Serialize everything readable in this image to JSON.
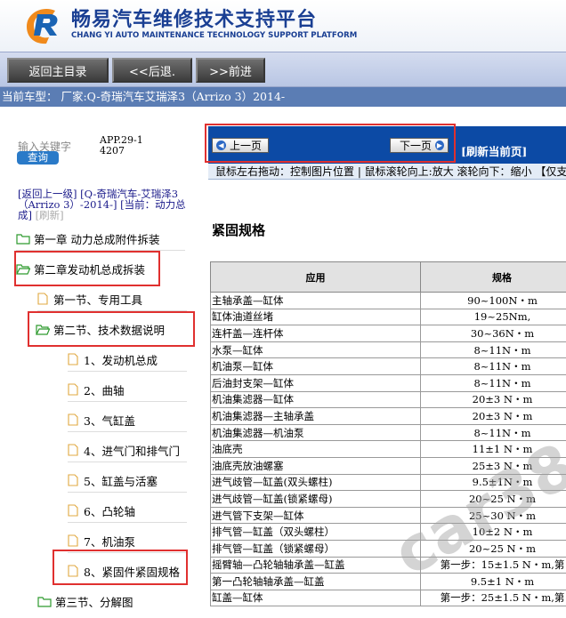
{
  "header": {
    "title_cn": "畅易汽车维修技术支持平台",
    "title_en": "CHANG YI AUTO MAINTENANCE TECHNOLOGY SUPPORT PLATFORM",
    "brand_colors": {
      "primary": "#1a3f93",
      "logo_orange": "#f08a1c",
      "logo_blue": "#1a64b4"
    }
  },
  "navbar": {
    "back_main": "返回主目录",
    "back": "<<后退.",
    "forward": ">>前进"
  },
  "vehicle": {
    "label": "当前车型： 厂家:Q-奇瑞汽车艾瑞泽3（Arrizo 3）2014-"
  },
  "sidebar": {
    "search_placeholder": "输入关键字",
    "search_button": "查询",
    "app_code": "APP.29-14207",
    "breadcrumb_back": "[返回上一级]",
    "breadcrumb_path": "[Q-奇瑞汽车-艾瑞泽3（Arrizo 3）-2014-]",
    "breadcrumb_current": "[当前：动力总成]",
    "breadcrumb_refresh": "[刷新]",
    "tree": [
      {
        "label": "第一章 动力总成附件拆装",
        "type": "folder"
      },
      {
        "label": "第二章发动机总成拆装",
        "type": "folder-open"
      },
      {
        "label": "第一节、专用工具",
        "type": "doc"
      },
      {
        "label": "第二节、技术数据说明",
        "type": "folder-open"
      },
      {
        "label": "1、发动机总成",
        "type": "doc"
      },
      {
        "label": "2、曲轴",
        "type": "doc"
      },
      {
        "label": "3、气缸盖",
        "type": "doc"
      },
      {
        "label": "4、进气门和排气门",
        "type": "doc"
      },
      {
        "label": "5、缸盖与活塞",
        "type": "doc"
      },
      {
        "label": "6、凸轮轴",
        "type": "doc"
      },
      {
        "label": "7、机油泵",
        "type": "doc"
      },
      {
        "label": "8、紧固件紧固规格",
        "type": "doc"
      },
      {
        "label": "第三节、分解图",
        "type": "folder"
      }
    ]
  },
  "content": {
    "prev_page": "上一页",
    "next_page": "下一页",
    "refresh_page": "[刷新当前页]",
    "hint": "鼠标左右拖动：控制图片位置 | 鼠标滚轮向上:放大  滚轮向下：缩小 【仅支",
    "doc_title": "紧固规格",
    "table_headers": [
      "应用",
      "规格"
    ],
    "rows": [
      [
        "主轴承盖—缸体",
        "90~100N・m"
      ],
      [
        "缸体油道丝堵",
        "19~25Nm,"
      ],
      [
        "连杆盖—连杆体",
        "30~36N・m"
      ],
      [
        "水泵—缸体",
        "8~11N・m"
      ],
      [
        "机油泵—缸体",
        "8~11N・m"
      ],
      [
        "后油封支架—缸体",
        "8~11N・m"
      ],
      [
        "机油集滤器—缸体",
        "20±3 N・m"
      ],
      [
        "机油集滤器—主轴承盖",
        "20±3 N・m"
      ],
      [
        "机油集滤器—机油泵",
        "8~11N・m"
      ],
      [
        "油底壳",
        "11±1 N・m"
      ],
      [
        "油底壳放油螺塞",
        "25±3 N・m"
      ],
      [
        "进气歧管—缸盖(双头螺柱)",
        "9.5±1N・m"
      ],
      [
        "进气歧管—缸盖(锁紧螺母)",
        "20~25 N・m"
      ],
      [
        "进气管下支架—缸体",
        "25~30 N・m"
      ],
      [
        "排气管—缸盖（双头螺柱）",
        "10±2 N・m"
      ],
      [
        "排气管—缸盖（锁紧螺母）",
        "20~25 N・m"
      ],
      [
        "摇臂轴—凸轮轴轴承盖—缸盖",
        "第一步：15±1.5 N・m,第"
      ],
      [
        "第一凸轮轴轴承盖—缸盖",
        "9.5±1 N・m"
      ],
      [
        "缸盖—缸体",
        "第一步：25±1.5 N・m,第"
      ]
    ],
    "watermark": "car38"
  }
}
